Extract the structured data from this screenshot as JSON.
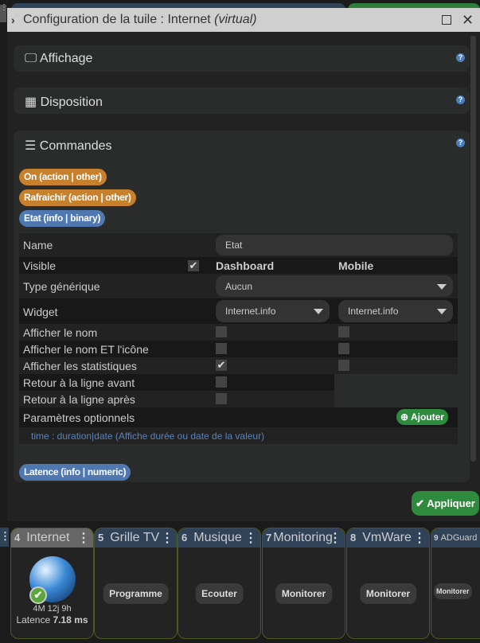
{
  "modal": {
    "title": "Configuration de la tuile : Internet",
    "title_suffix": "(virtual)"
  },
  "sections": [
    {
      "label": "Affichage",
      "icon": "monitor-icon"
    },
    {
      "label": "Disposition",
      "icon": "grid-icon"
    },
    {
      "label": "Commandes",
      "icon": "list-icon"
    }
  ],
  "commands": [
    {
      "label": "On (action | other)",
      "color": "#c7802b"
    },
    {
      "label": "Rafraichir (action | other)",
      "color": "#c7802b"
    },
    {
      "label": "Etat (info | binary)",
      "color": "#4f78b0"
    },
    {
      "label": "Latence (info | numeric)",
      "color": "#4f78b0"
    }
  ],
  "form": {
    "name_label": "Name",
    "name_value": "Etat",
    "visible_label": "Visible",
    "visible_checked": true,
    "col_dashboard": "Dashboard",
    "col_mobile": "Mobile",
    "generic_type_label": "Type générique",
    "generic_type_value": "Aucun",
    "widget_label": "Widget",
    "widget_dashboard": "Internet.info",
    "widget_mobile": "Internet.info",
    "options": [
      {
        "label": "Afficher le nom",
        "dashboard": false,
        "mobile": false
      },
      {
        "label": "Afficher le nom ET l'icône",
        "dashboard": false,
        "mobile": false
      },
      {
        "label": "Afficher les statistiques",
        "dashboard": true,
        "mobile": false
      },
      {
        "label": "Retour à la ligne avant",
        "dashboard": false
      },
      {
        "label": "Retour à la ligne après",
        "dashboard": false
      }
    ],
    "optional_label": "Paramètres optionnels",
    "add_label": "Ajouter",
    "hint": "time : duration|date (Affiche durée ou date de la valeur)"
  },
  "apply_label": "Appliquer",
  "tiles": [
    {
      "num": "4",
      "name": "Internet",
      "duration": "4M 12j 9h",
      "latency_label": "Latence",
      "latency_value": "7.18 ms"
    },
    {
      "num": "5",
      "name": "Grille TV",
      "button": "Programme"
    },
    {
      "num": "6",
      "name": "Musique",
      "button": "Ecouter"
    },
    {
      "num": "7",
      "name": "Monitoring",
      "button": "Monitorer"
    },
    {
      "num": "8",
      "name": "VmWare",
      "button": "Monitorer"
    },
    {
      "num": "9",
      "name": "ADGuard",
      "button": "Monitorer"
    }
  ]
}
